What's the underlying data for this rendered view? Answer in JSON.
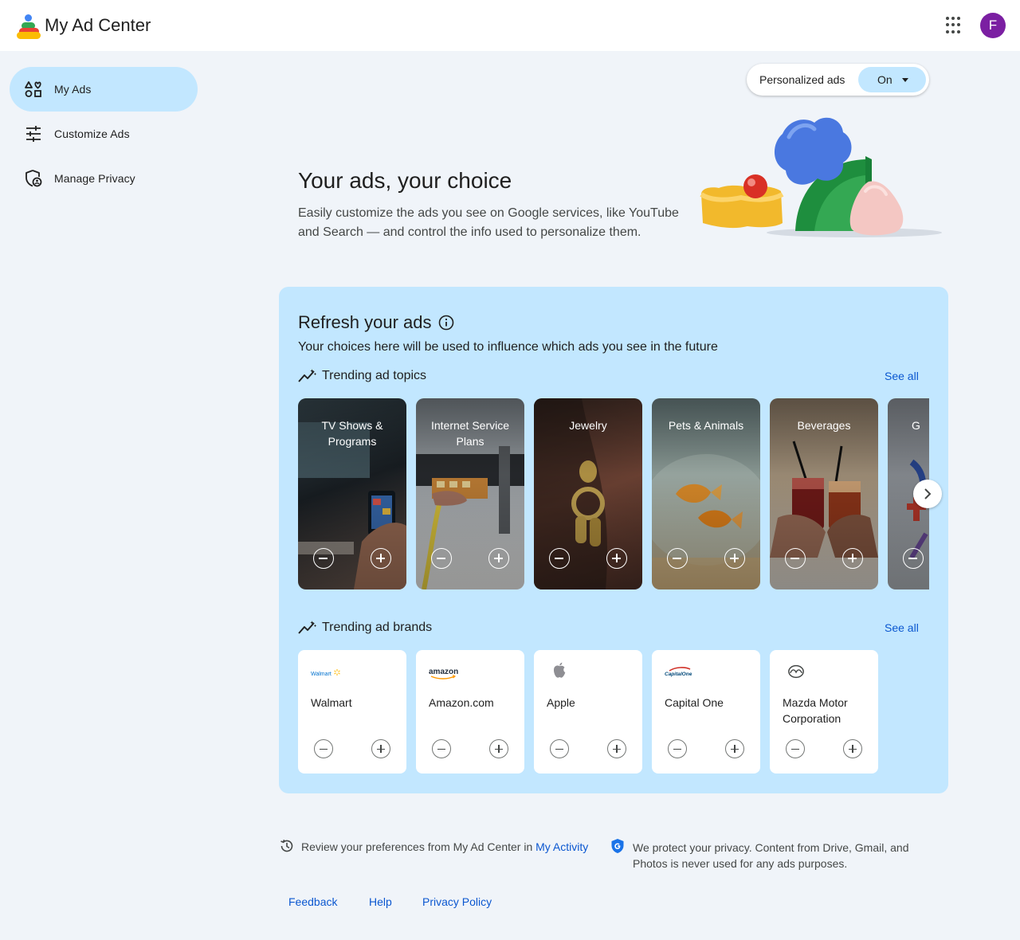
{
  "header": {
    "app_title": "My Ad Center",
    "avatar_letter": "F",
    "avatar_color": "#7b1fa2"
  },
  "sidebar": {
    "items": [
      {
        "label": "My Ads",
        "icon": "category-icon",
        "active": true
      },
      {
        "label": "Customize Ads",
        "icon": "tune-icon",
        "active": false
      },
      {
        "label": "Manage Privacy",
        "icon": "shield-person-icon",
        "active": false
      }
    ]
  },
  "personalized_ads": {
    "label": "Personalized ads",
    "value": "On"
  },
  "hero": {
    "title": "Your ads, your choice",
    "description": "Easily customize the ads you see on Google services, like YouTube and Search — and control the info used to personalize them."
  },
  "refresh": {
    "title": "Refresh your ads",
    "subtitle": "Your choices here will be used to influence which ads you see in the future",
    "topics_section": {
      "title": "Trending ad topics",
      "see_all": "See all",
      "items": [
        {
          "label": "TV Shows & Programs"
        },
        {
          "label": "Internet Service Plans"
        },
        {
          "label": "Jewelry"
        },
        {
          "label": "Pets & Animals"
        },
        {
          "label": "Beverages"
        },
        {
          "label": "G"
        }
      ]
    },
    "brands_section": {
      "title": "Trending ad brands",
      "see_all": "See all",
      "items": [
        {
          "name": "Walmart",
          "logo_text": "Walmart",
          "logo_color": "#0071ce"
        },
        {
          "name": "Amazon.com",
          "logo_text": "amazon",
          "logo_color": "#232f3e"
        },
        {
          "name": "Apple",
          "logo_text": "",
          "logo_color": "#8e8e93"
        },
        {
          "name": "Capital One",
          "logo_text": "CapitalOne",
          "logo_color": "#004879"
        },
        {
          "name": "Mazda Motor Corporation",
          "logo_text": "",
          "logo_color": "#444746"
        }
      ]
    }
  },
  "footer": {
    "review_text": "Review your preferences from My Ad Center in ",
    "review_link": "My Activity",
    "privacy_text": "We protect your privacy. Content from Drive, Gmail, and Photos is never used for any ads purposes.",
    "links": [
      "Feedback",
      "Help",
      "Privacy Policy"
    ]
  },
  "colors": {
    "accent": "#0b57d0",
    "panel": "#c2e7ff",
    "background": "#f0f4f9"
  }
}
